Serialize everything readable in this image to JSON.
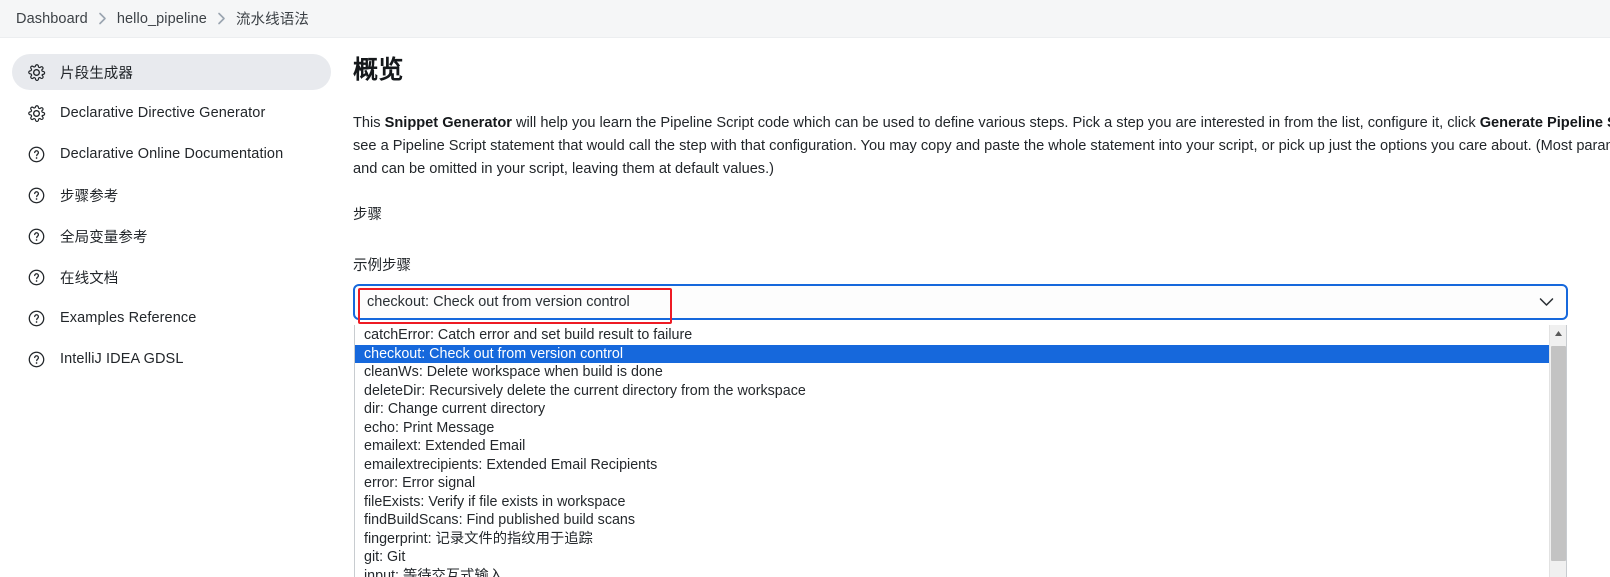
{
  "breadcrumb": {
    "items": [
      {
        "label": "Dashboard"
      },
      {
        "label": "hello_pipeline"
      },
      {
        "label": "流水线语法"
      }
    ]
  },
  "sidebar": {
    "items": [
      {
        "label": "片段生成器",
        "icon": "gear-icon",
        "active": true
      },
      {
        "label": "Declarative Directive Generator",
        "icon": "gear-icon",
        "active": false
      },
      {
        "label": "Declarative Online Documentation",
        "icon": "help-circle-icon",
        "active": false
      },
      {
        "label": "步骤参考",
        "icon": "help-circle-icon",
        "active": false
      },
      {
        "label": "全局变量参考",
        "icon": "help-circle-icon",
        "active": false
      },
      {
        "label": "在线文档",
        "icon": "help-circle-icon",
        "active": false
      },
      {
        "label": "Examples Reference",
        "icon": "help-circle-icon",
        "active": false
      },
      {
        "label": "IntelliJ IDEA GDSL",
        "icon": "help-circle-icon",
        "active": false
      }
    ]
  },
  "main": {
    "title": "概览",
    "intro": {
      "part1": "This ",
      "bold1": "Snippet Generator",
      "part2": " will help you learn the Pipeline Script code which can be used to define various steps. Pick a step you are interested in from the list, configure it, click ",
      "bold2": "Generate Pipeline Script",
      "part3": ", and you will see a Pipeline Script statement that would call the step with that configuration. You may copy and paste the whole statement into your script, or pick up just the options you care about. (Most parameters are optional and can be omitted in your script, leaving them at default values.)"
    },
    "steps_label": "步骤",
    "sample_step_label": "示例步骤"
  },
  "combobox": {
    "selected_value": "checkout: Check out from version control",
    "caret_icon": "chevron-down-icon",
    "expanded": true,
    "options": [
      {
        "label": "catchError: Catch error and set build result to failure",
        "selected": false
      },
      {
        "label": "checkout: Check out from version control",
        "selected": true
      },
      {
        "label": "cleanWs: Delete workspace when build is done",
        "selected": false
      },
      {
        "label": "deleteDir: Recursively delete the current directory from the workspace",
        "selected": false
      },
      {
        "label": "dir: Change current directory",
        "selected": false
      },
      {
        "label": "echo: Print Message",
        "selected": false
      },
      {
        "label": "emailext: Extended Email",
        "selected": false
      },
      {
        "label": "emailextrecipients: Extended Email Recipients",
        "selected": false
      },
      {
        "label": "error: Error signal",
        "selected": false
      },
      {
        "label": "fileExists: Verify if file exists in workspace",
        "selected": false
      },
      {
        "label": "findBuildScans: Find published build scans",
        "selected": false
      },
      {
        "label": "fingerprint: 记录文件的指纹用于追踪",
        "selected": false
      },
      {
        "label": "git: Git",
        "selected": false
      },
      {
        "label": "input: 等待交互式输入",
        "selected": false
      }
    ],
    "scrollbar": {
      "up_arrow_icon": "scroll-up-arrow-icon"
    }
  },
  "colors": {
    "focus_border": "#1668dc",
    "highlight": "#1668dc",
    "annotation": "#ee1b24",
    "breadcrumb_bg": "#f5f6f7",
    "sidebar_active_bg": "#e8eaee"
  }
}
